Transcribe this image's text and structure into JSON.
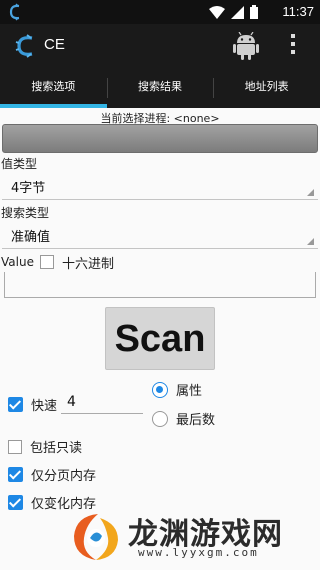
{
  "status_bar": {
    "time": "11:37"
  },
  "app_bar": {
    "title": "CE"
  },
  "tabs": [
    {
      "label": "搜索选项",
      "active": true
    },
    {
      "label": "搜索结果",
      "active": false
    },
    {
      "label": "地址列表",
      "active": false
    }
  ],
  "process": {
    "label": "当前选择进程: <none>"
  },
  "value_type": {
    "label": "值类型",
    "selected": "4字节"
  },
  "search_type": {
    "label": "搜索类型",
    "selected": "准确值"
  },
  "value": {
    "label": "Value",
    "hex_label": "十六进制",
    "hex_checked": false,
    "input_value": ""
  },
  "scan_button": {
    "label": "Scan"
  },
  "options": {
    "speed": {
      "label": "快速",
      "checked": true,
      "value": "4"
    },
    "read_only": {
      "label": "包括只读",
      "checked": false
    },
    "paged_memory": {
      "label": "仅分页内存",
      "checked": true
    },
    "changed_memory": {
      "label": "仅变化内存",
      "checked": true
    }
  },
  "radio_options": [
    {
      "label": "属性",
      "selected": true
    },
    {
      "label": "最后数",
      "selected": false
    }
  ],
  "watermark": {
    "name": "龙渊游戏网",
    "url": "www.lyyxgm.com"
  },
  "colors": {
    "accent": "#33b5e5",
    "checkbox": "#1e88e5",
    "toolbar": "#1a1a1a"
  }
}
